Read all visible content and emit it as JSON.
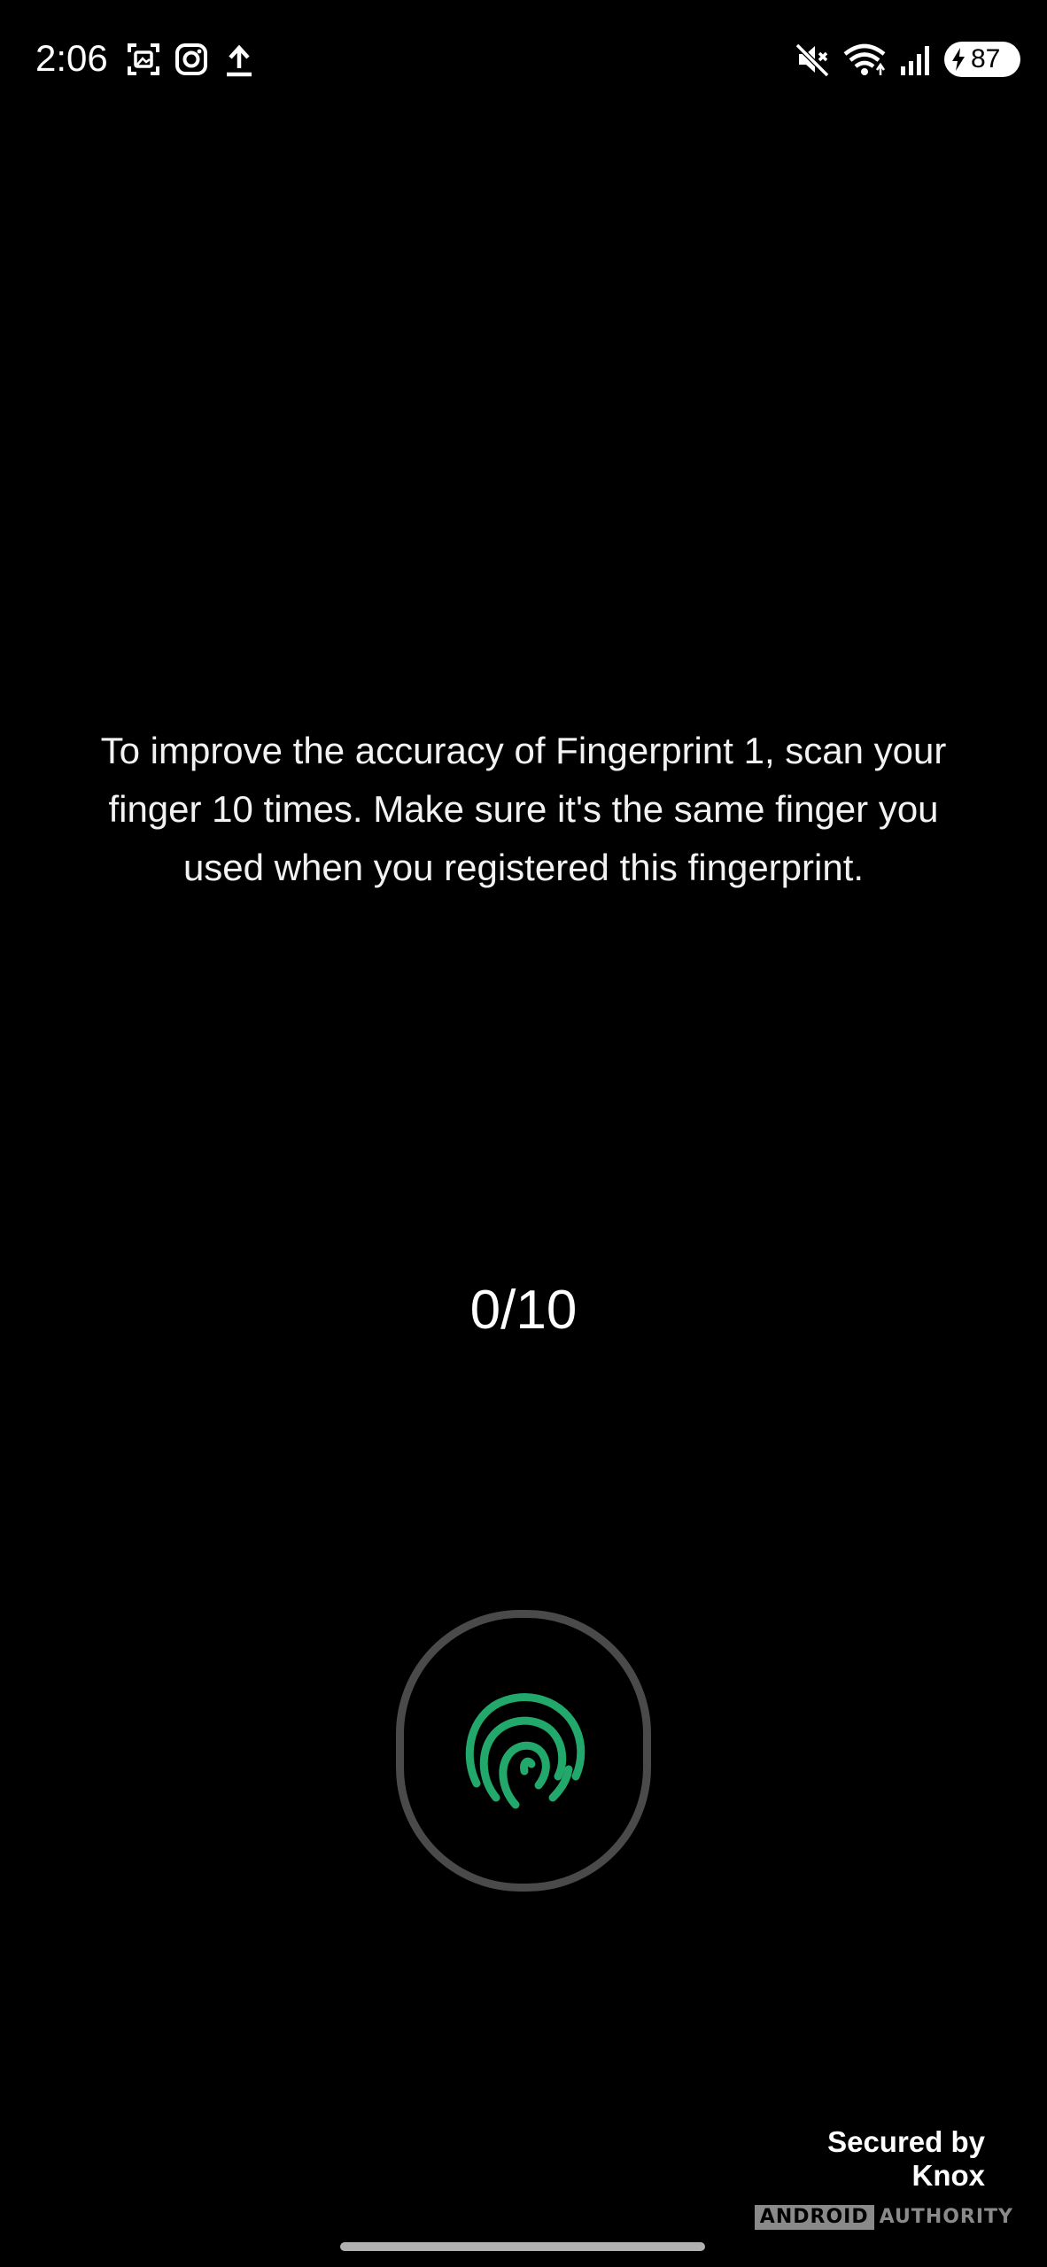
{
  "status_bar": {
    "time": "2:06",
    "left_icons": [
      "screenshot-icon",
      "instagram-icon",
      "upload-icon"
    ],
    "right_icons": [
      "mute-icon",
      "wifi-icon",
      "signal-icon"
    ],
    "battery_level": "87",
    "battery_charging": true
  },
  "enrollment": {
    "instruction": "To improve the accuracy of Fingerprint 1, scan your finger 10 times. Make sure it's the same finger you used when you registered this fingerprint.",
    "progress_text": "0/10",
    "progress_fraction": 0,
    "sensor_icon": "fingerprint-icon",
    "accent_color": "#22a86a"
  },
  "footer": {
    "secured_by_line1": "Secured by",
    "secured_by_line2": "Knox"
  },
  "watermark": {
    "box_text": "ANDROID",
    "text": "AUTHORITY"
  }
}
